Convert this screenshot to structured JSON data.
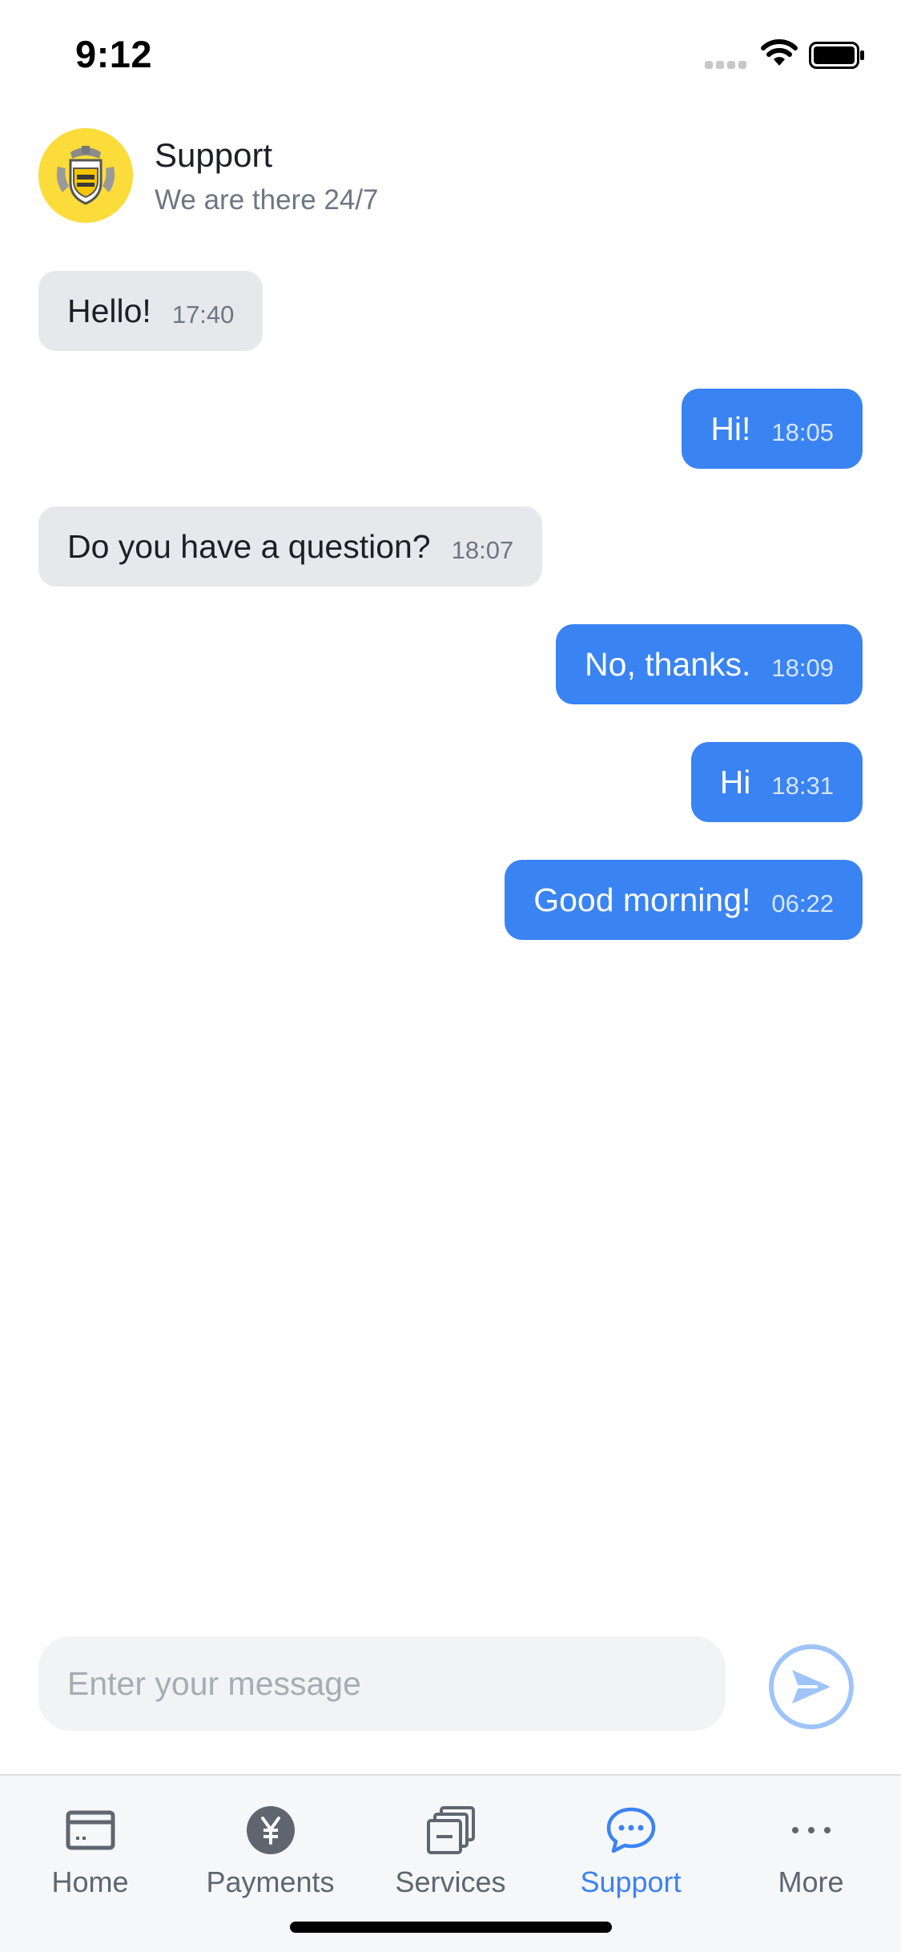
{
  "status_bar": {
    "time": "9:12",
    "icons": [
      "cellular-signal-icon",
      "wifi-icon",
      "battery-icon"
    ]
  },
  "header": {
    "title": "Support",
    "subtitle": "We are there 24/7",
    "avatar_icon": "bank-crest-logo"
  },
  "messages": [
    {
      "direction": "in",
      "text": "Hello!",
      "time": "17:40"
    },
    {
      "direction": "out",
      "text": "Hi!",
      "time": "18:05"
    },
    {
      "direction": "in",
      "text": "Do you have a question?",
      "time": "18:07"
    },
    {
      "direction": "out",
      "text": "No, thanks.",
      "time": "18:09"
    },
    {
      "direction": "out",
      "text": "Hi",
      "time": "18:31"
    },
    {
      "direction": "out",
      "text": "Good morning!",
      "time": "06:22"
    }
  ],
  "composer": {
    "placeholder": "Enter your message",
    "value": "",
    "send_icon": "send-icon"
  },
  "tabs": [
    {
      "label": "Home",
      "icon": "card-icon",
      "active": false
    },
    {
      "label": "Payments",
      "icon": "yen-coin-icon",
      "active": false
    },
    {
      "label": "Services",
      "icon": "stacked-cards-icon",
      "active": false
    },
    {
      "label": "Support",
      "icon": "chat-bubble-icon",
      "active": true
    },
    {
      "label": "More",
      "icon": "more-dots-icon",
      "active": false
    }
  ],
  "colors": {
    "accent": "#3a83f3",
    "incoming_bubble": "#e7e8ec",
    "avatar_bg": "#fbdc3a",
    "send_button_border": "#9fc4f9"
  }
}
